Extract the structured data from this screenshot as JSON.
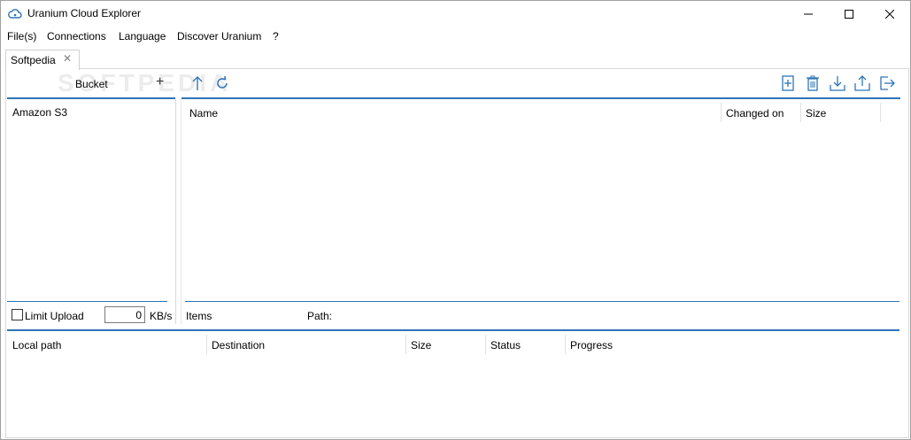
{
  "window": {
    "title": "Uranium Cloud Explorer",
    "accent": "#2e75b6"
  },
  "menu": [
    "File(s)",
    "Connections",
    "Language",
    "Discover Uranium",
    "?"
  ],
  "tab": {
    "label": "Softpedia",
    "close_glyph": "✕"
  },
  "watermark": "SOFTPEDIA",
  "left_pane": {
    "header": "Bucket",
    "add_glyph": "+",
    "items": [
      "Amazon S3"
    ],
    "limit_upload_label": "Limit Upload",
    "limit_value": "0",
    "limit_unit": "KB/s"
  },
  "toolbar_icons": [
    "up-arrow-icon",
    "refresh-icon",
    "new-file-icon",
    "delete-icon",
    "download-icon",
    "upload-icon",
    "exit-icon"
  ],
  "file_list": {
    "columns": [
      "Name",
      "Changed on",
      "Size"
    ]
  },
  "status_bar": {
    "items_label": "Items",
    "path_label": "Path:"
  },
  "transfers": {
    "columns": [
      "Local path",
      "Destination",
      "Size",
      "Status",
      "Progress"
    ]
  }
}
